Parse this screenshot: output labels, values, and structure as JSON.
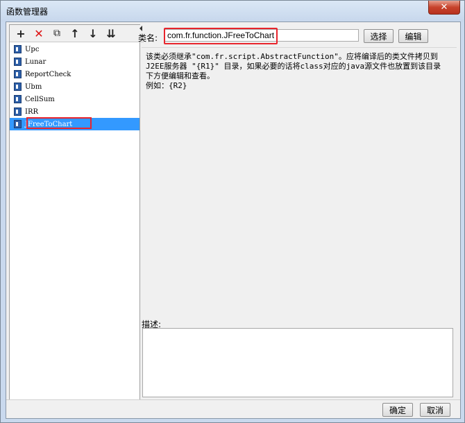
{
  "window": {
    "title": "函数管理器",
    "close_glyph": "✕"
  },
  "toolbar": {
    "add_icon": "+",
    "delete_icon": "✕",
    "copy_icon": "⧉",
    "up_icon": "↑",
    "down_icon": "↓",
    "sort_icon": "⇊"
  },
  "functions": [
    {
      "label": "Upc"
    },
    {
      "label": "Lunar"
    },
    {
      "label": "ReportCheck"
    },
    {
      "label": "Ubm"
    },
    {
      "label": "CellSum"
    },
    {
      "label": "IRR"
    },
    {
      "label": "JFreeToChart",
      "selected": true
    }
  ],
  "class_name": {
    "label": "类名:",
    "value": "com.fr.function.JFreeToChart",
    "select_button": "选择",
    "edit_button": "编辑"
  },
  "info": {
    "line1": "该类必须继承\"com.fr.script.AbstractFunction\"。应将编译后的类文件拷贝到",
    "line2": "J2EE服务器 \"{R1}\" 目录，如果必要的话将class对应的java源文件也放置到该目录",
    "line3": "下方便编辑和查看。",
    "line4": "例如：{R2}"
  },
  "description": {
    "label": "描述:",
    "value": ""
  },
  "footer": {
    "ok_button": "确定",
    "cancel_button": "取消"
  },
  "colors": {
    "selection": "#3399ff",
    "highlight_border": "#e8242c"
  }
}
